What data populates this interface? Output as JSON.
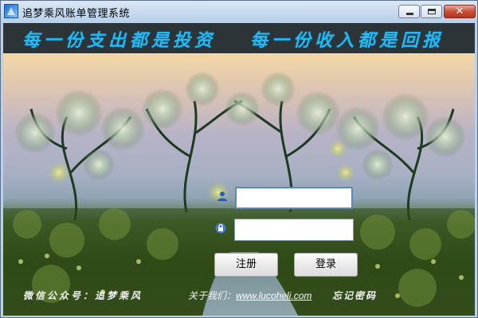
{
  "window": {
    "title": "追梦乘风账单管理系统",
    "controls": {
      "minimize": "minimize",
      "maximize": "maximize",
      "close": "✕"
    }
  },
  "banner": {
    "slogan_left": "每一份支出都是投资",
    "slogan_right": "每一份收入都是回报",
    "color": "#27b8f0"
  },
  "login": {
    "username_value": "",
    "password_value": "",
    "register_label": "注册",
    "login_label": "登录",
    "user_icon": "user-icon",
    "lock_icon": "lock-icon"
  },
  "footer": {
    "wechat": "微信公众号：追梦乘风",
    "about_label": "关于我们：",
    "about_link": "www.lucoheli.com",
    "forgot": "忘记密码"
  },
  "colors": {
    "banner_bg": "#2c3437",
    "field_border_focus": "#5a88b8",
    "close_button": "#c94e36"
  }
}
